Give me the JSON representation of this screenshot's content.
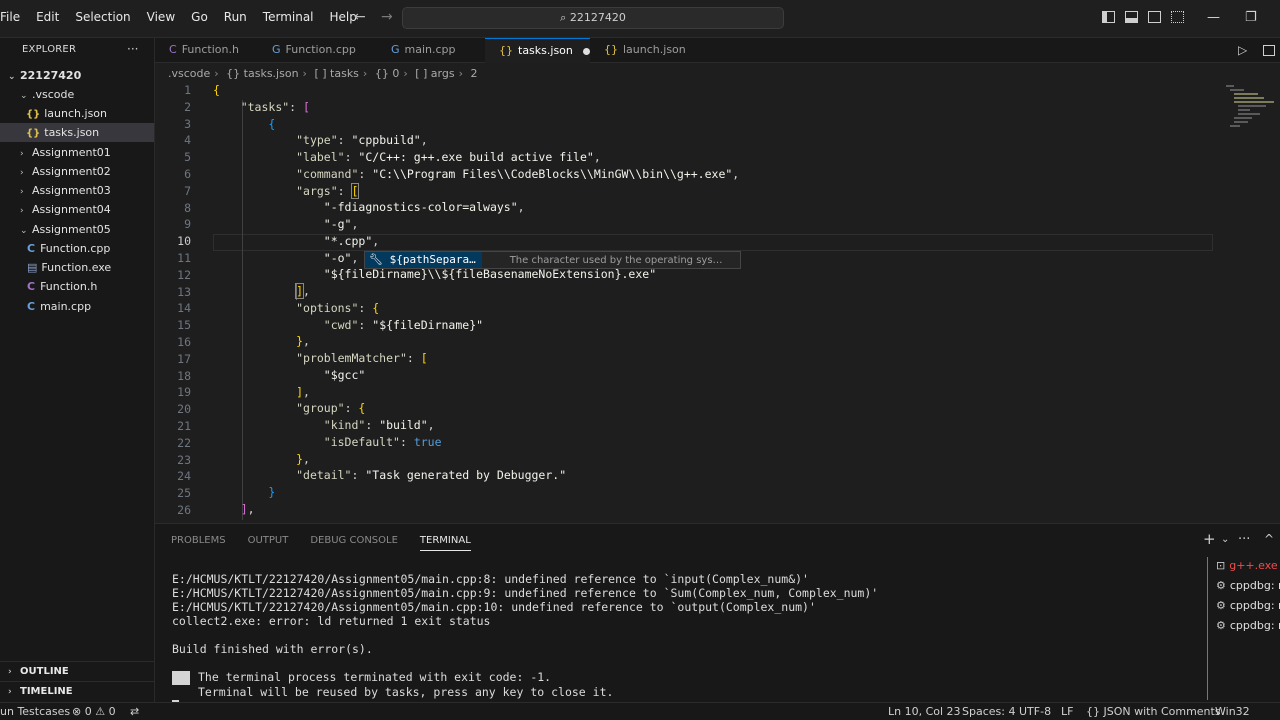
{
  "menu": [
    "File",
    "Edit",
    "Selection",
    "View",
    "Go",
    "Run",
    "Terminal",
    "Help"
  ],
  "search": {
    "text": "22127420",
    "icon": "search-icon"
  },
  "explorer": {
    "title": "EXPLORER",
    "more": "···",
    "root": "22127420",
    "items": [
      {
        "label": ".vscode",
        "type": "folder",
        "open": true
      },
      {
        "label": "launch.json",
        "type": "json"
      },
      {
        "label": "tasks.json",
        "type": "json",
        "selected": true
      },
      {
        "label": "Assignment01",
        "type": "folder"
      },
      {
        "label": "Assignment02",
        "type": "folder"
      },
      {
        "label": "Assignment03",
        "type": "folder"
      },
      {
        "label": "Assignment04",
        "type": "folder"
      },
      {
        "label": "Assignment05",
        "type": "folder",
        "open": true
      },
      {
        "label": "Function.cpp",
        "type": "cpp"
      },
      {
        "label": "Function.exe",
        "type": "exe"
      },
      {
        "label": "Function.h",
        "type": "cpp"
      },
      {
        "label": "main.cpp",
        "type": "cpp"
      }
    ],
    "outline": "OUTLINE",
    "timeline": "TIMELINE"
  },
  "tabs": [
    {
      "label": "Function.h",
      "icon": "C"
    },
    {
      "label": "Function.cpp",
      "icon": "G"
    },
    {
      "label": "main.cpp",
      "icon": "G"
    },
    {
      "label": "tasks.json",
      "icon": "{}",
      "active": true,
      "dirty": true
    },
    {
      "label": "launch.json",
      "icon": "{}"
    }
  ],
  "breadcrumb": [
    ".vscode",
    "{} tasks.json",
    "[ ] tasks",
    "{} 0",
    "[ ] args",
    "2"
  ],
  "code": {
    "lines": [
      "1",
      "2",
      "3",
      "4",
      "5",
      "6",
      "7",
      "8",
      "9",
      "10",
      "11",
      "12",
      "13",
      "14",
      "15",
      "16",
      "17",
      "18",
      "19",
      "20",
      "21",
      "22",
      "23",
      "24",
      "25",
      "26"
    ],
    "current_line": "10"
  },
  "suggestion": {
    "label": "${pathSepara…",
    "description": "The character used by the operating sys…"
  },
  "panel": {
    "tabs": [
      "PROBLEMS",
      "OUTPUT",
      "DEBUG CONSOLE",
      "TERMINAL"
    ],
    "active": "TERMINAL",
    "terminal_lines": [
      "E:/HCMUS/KTLT/22127420/Assignment05/main.cpp:8: undefined reference to `input(Complex_num&)'",
      "E:/HCMUS/KTLT/22127420/Assignment05/main.cpp:9: undefined reference to `Sum(Complex_num, Complex_num)'",
      "E:/HCMUS/KTLT/22127420/Assignment05/main.cpp:10: undefined reference to `output(Complex_num)'",
      "collect2.exe: error: ld returned 1 exit status",
      "",
      "Build finished with error(s).",
      ""
    ],
    "terminated_1": "The terminal process terminated with exit code: -1.",
    "terminated_2": "Terminal will be reused by tasks, press any key to close it.",
    "terminals": [
      "g++.exe",
      "cppdbg: r",
      "cppdbg: r",
      "cppdbg: r"
    ]
  },
  "status": {
    "left_run": "un Testcases",
    "problems": "⊗ 0 ⚠ 0",
    "position": "Ln 10, Col 23",
    "spaces": "Spaces: 4",
    "encoding": "UTF-8",
    "eol": "LF",
    "language": "{} JSON with Comments",
    "platform": "Win32"
  }
}
